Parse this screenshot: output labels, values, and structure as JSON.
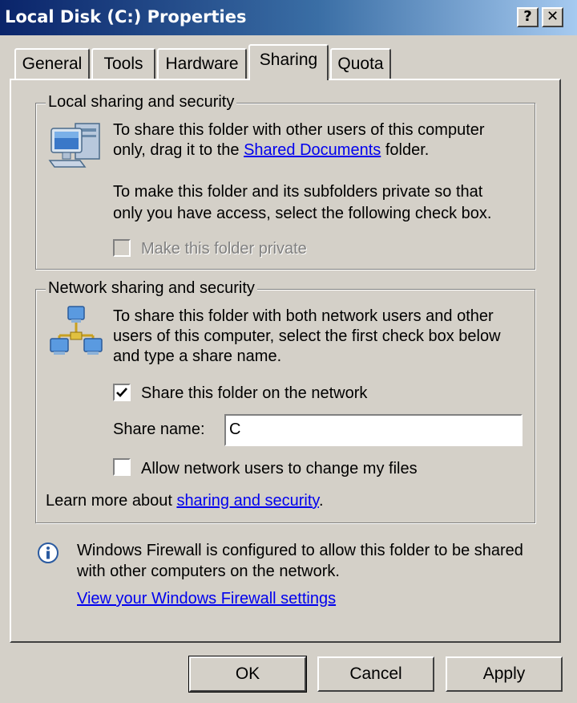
{
  "window": {
    "title": "Local Disk (C:) Properties",
    "help_label": "?",
    "close_label": "✕"
  },
  "tabs": [
    {
      "label": "General",
      "active": false
    },
    {
      "label": "Tools",
      "active": false
    },
    {
      "label": "Hardware",
      "active": false
    },
    {
      "label": "Sharing",
      "active": true
    },
    {
      "label": "Quota",
      "active": false
    }
  ],
  "local_sharing": {
    "legend": "Local sharing and security",
    "icon": "computer-icon",
    "line1": "To share this folder with other users of this computer",
    "line2_prefix": "only, drag it to the ",
    "line2_link": "Shared Documents",
    "line2_suffix": " folder.",
    "line3": "To make this folder and its subfolders private so that",
    "line4": "only you have access, select the following check box.",
    "private_label": "Make this folder private",
    "private_checked": false,
    "private_enabled": false
  },
  "network_sharing": {
    "legend": "Network sharing and security",
    "icon": "network-icon",
    "line1": "To share this folder with both network users and other",
    "line2": "users of this computer, select the first check box below",
    "line3": "and type a share name.",
    "share_label": "Share this folder on the network",
    "share_checked": true,
    "share_name_label": "Share name:",
    "share_name_value": "C",
    "allow_label": "Allow network users to change my files",
    "allow_checked": false,
    "learn_prefix": "Learn more about ",
    "learn_link": "sharing and security",
    "learn_suffix": "."
  },
  "firewall": {
    "icon": "info-icon",
    "line1": "Windows Firewall is configured to allow this folder to be shared",
    "line2": "with other computers on the network.",
    "link": "View your Windows Firewall settings"
  },
  "buttons": {
    "ok": "OK",
    "cancel": "Cancel",
    "apply": "Apply"
  },
  "colors": {
    "titlebar_start": "#0a246a",
    "titlebar_end": "#a6caf0",
    "face": "#d4d0c8",
    "link": "#0000ee"
  }
}
